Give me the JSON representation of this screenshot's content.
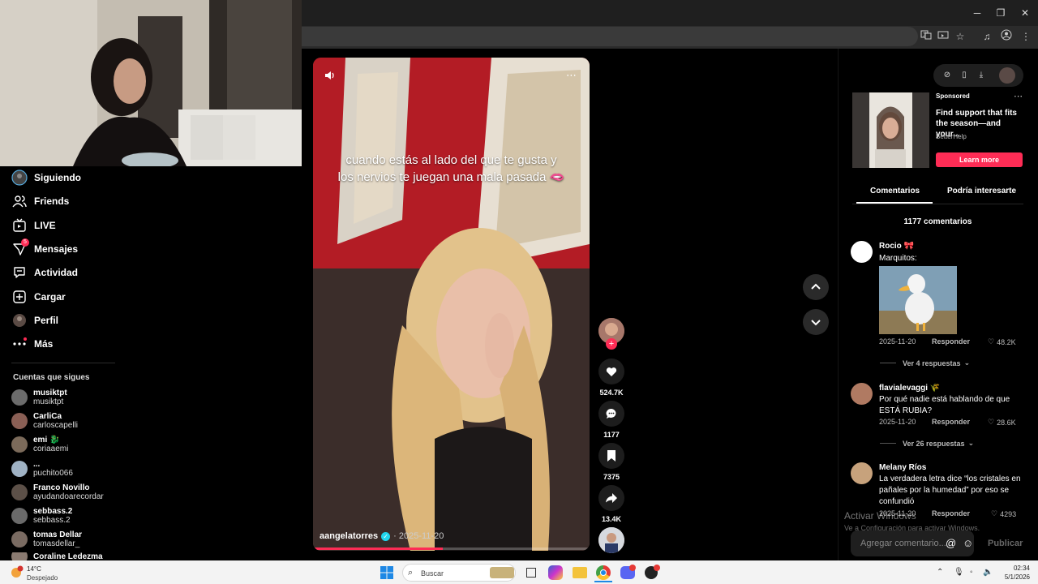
{
  "browser": {
    "window_controls": {
      "minimize": "─",
      "maximize": "❐",
      "close": "✕"
    }
  },
  "sidebar": {
    "nav": [
      {
        "label": "Siguiendo",
        "icon": "avatar-icon"
      },
      {
        "label": "Friends",
        "icon": "friends-icon"
      },
      {
        "label": "LIVE",
        "icon": "live-icon"
      },
      {
        "label": "Mensajes",
        "icon": "messages-icon",
        "badge": "5"
      },
      {
        "label": "Actividad",
        "icon": "activity-icon"
      },
      {
        "label": "Cargar",
        "icon": "upload-icon"
      },
      {
        "label": "Perfil",
        "icon": "profile-icon"
      },
      {
        "label": "Más",
        "icon": "more-icon"
      }
    ],
    "following_title": "Cuentas que sigues",
    "following": [
      {
        "name": "musiktpt",
        "user": "musiktpt"
      },
      {
        "name": "CarliCa",
        "user": "carloscapelli"
      },
      {
        "name": "emi 🐉",
        "user": "coriaaemi"
      },
      {
        "name": "...",
        "user": "puchito066"
      },
      {
        "name": "Franco Novillo",
        "user": "ayudandoarecordar"
      },
      {
        "name": "sebbass.2",
        "user": "sebbass.2"
      },
      {
        "name": "tomas Dellar",
        "user": "tomasdellar_"
      },
      {
        "name": "Coraline Ledezma",
        "user": ""
      }
    ]
  },
  "video": {
    "caption": "cuando estás al lado del que te gusta y los nervios te juegan una mala pasada 🫦",
    "author": "aangelatorres",
    "date": "· 2025-11-20",
    "progress": 0.47,
    "actions": {
      "likes": "524.7K",
      "comments": "1177",
      "saves": "7375",
      "shares": "13.4K"
    }
  },
  "ad": {
    "sponsored": "Sponsored",
    "title": "Find support that fits the season—and your...",
    "brand": "BetterHelp",
    "cta": "Learn more"
  },
  "tabs": {
    "comments": "Comentarios",
    "interesting": "Podría interesarte"
  },
  "comments_count": "1177 comentarios",
  "comments": [
    {
      "name": "Rocio 🎀",
      "text": "Marquitos:",
      "date": "2025-11-20",
      "reply": "Responder",
      "likes": "48.2K",
      "more": "Ver 4 respuestas"
    },
    {
      "name": "flavialevaggi 🌾",
      "text": "Por qué nadie está hablando de que ESTÁ RUBIA?",
      "date": "2025-11-20",
      "reply": "Responder",
      "likes": "28.6K",
      "more": "Ver 26 respuestas"
    },
    {
      "name": "Melany Ríos",
      "text": "La verdadera letra dice “los cristales en pañales por la humedad” por eso se confundió",
      "date": "2025-11-20",
      "reply": "Responder",
      "likes": "4293"
    }
  ],
  "windows_watermark": {
    "line1": "Activar Windows",
    "line2": "Ve a Configuración para activar Windows."
  },
  "comment_input": {
    "placeholder": "Agregar comentario...",
    "publish": "Publicar"
  },
  "taskbar": {
    "weather_temp": "14°C",
    "weather_desc": "Despejado",
    "search_placeholder": "Buscar",
    "time": "02:34",
    "date": "5/1/2026"
  },
  "colors": {
    "accent": "#fe2c55",
    "background": "#000000"
  }
}
